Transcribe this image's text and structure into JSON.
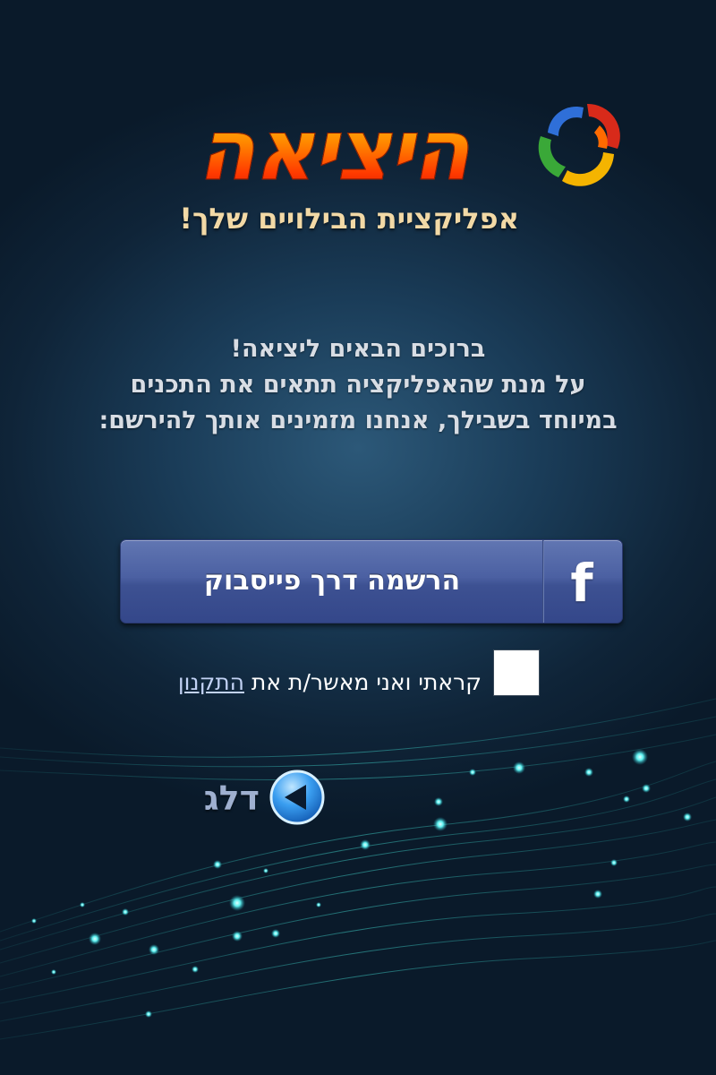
{
  "app": {
    "logo_title": "היציאה",
    "tagline": "אפליקציית הבילויים שלך!"
  },
  "welcome": {
    "line1": "ברוכים הבאים ליציאה!",
    "line2": "על מנת שהאפליקציה תתאים את התכנים",
    "line3": "במיוחד בשבילך, אנחנו מזמינים אותך להירשם:"
  },
  "facebook_button": {
    "label": "הרשמה דרך פייסבוק",
    "icon": "facebook-icon",
    "logo_glyph": "f"
  },
  "terms": {
    "text": "קראתי ואני מאשר/ת את ",
    "link_text": "התקנון",
    "checked": false
  },
  "skip": {
    "label": "דלג",
    "icon": "arrow-left-circle-icon"
  },
  "colors": {
    "background": "#1a3c58",
    "button": "#4b60a2",
    "logo_text": "#ff6a00",
    "tagline": "#f2d9a6",
    "link": "#c2d2f4"
  }
}
